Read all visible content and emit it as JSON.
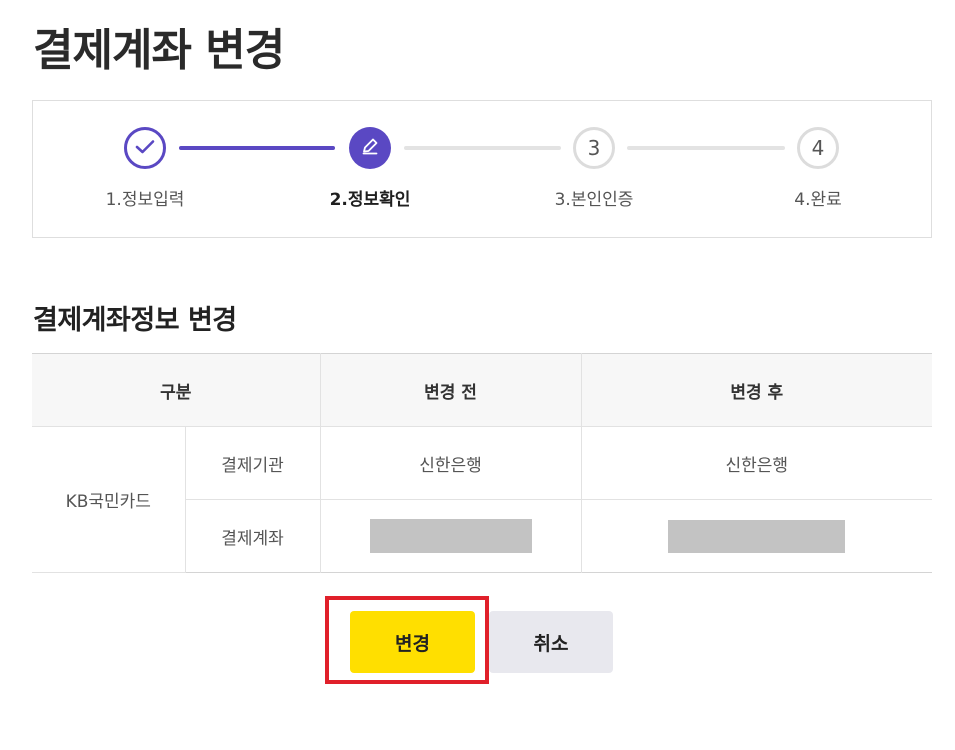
{
  "page": {
    "title": "결제계좌 변경"
  },
  "stepper": {
    "steps": [
      {
        "label": "1.정보입력",
        "state": "completed",
        "icon": "check-icon"
      },
      {
        "label": "2.정보확인",
        "state": "current",
        "icon": "pencil-icon"
      },
      {
        "label": "3.본인인증",
        "state": "pending",
        "number": "3"
      },
      {
        "label": "4.완료",
        "state": "pending",
        "number": "4"
      }
    ],
    "colors": {
      "active": "#5a48c3",
      "inactive": "#e3e3e3"
    }
  },
  "section": {
    "title": "결제계좌정보 변경"
  },
  "table": {
    "headers": {
      "category": "구분",
      "before": "변경 전",
      "after": "변경 후"
    },
    "provider": "KB국민카드",
    "rows": [
      {
        "label": "결제기관",
        "before": "신한은행",
        "after": "신한은행"
      },
      {
        "label": "결제계좌",
        "before": "",
        "after": "",
        "masked": true
      }
    ]
  },
  "actions": {
    "change_label": "변경",
    "cancel_label": "취소",
    "change_color": "#ffdf00",
    "cancel_color": "#e8e8ee",
    "highlight_color": "#e0202a"
  }
}
